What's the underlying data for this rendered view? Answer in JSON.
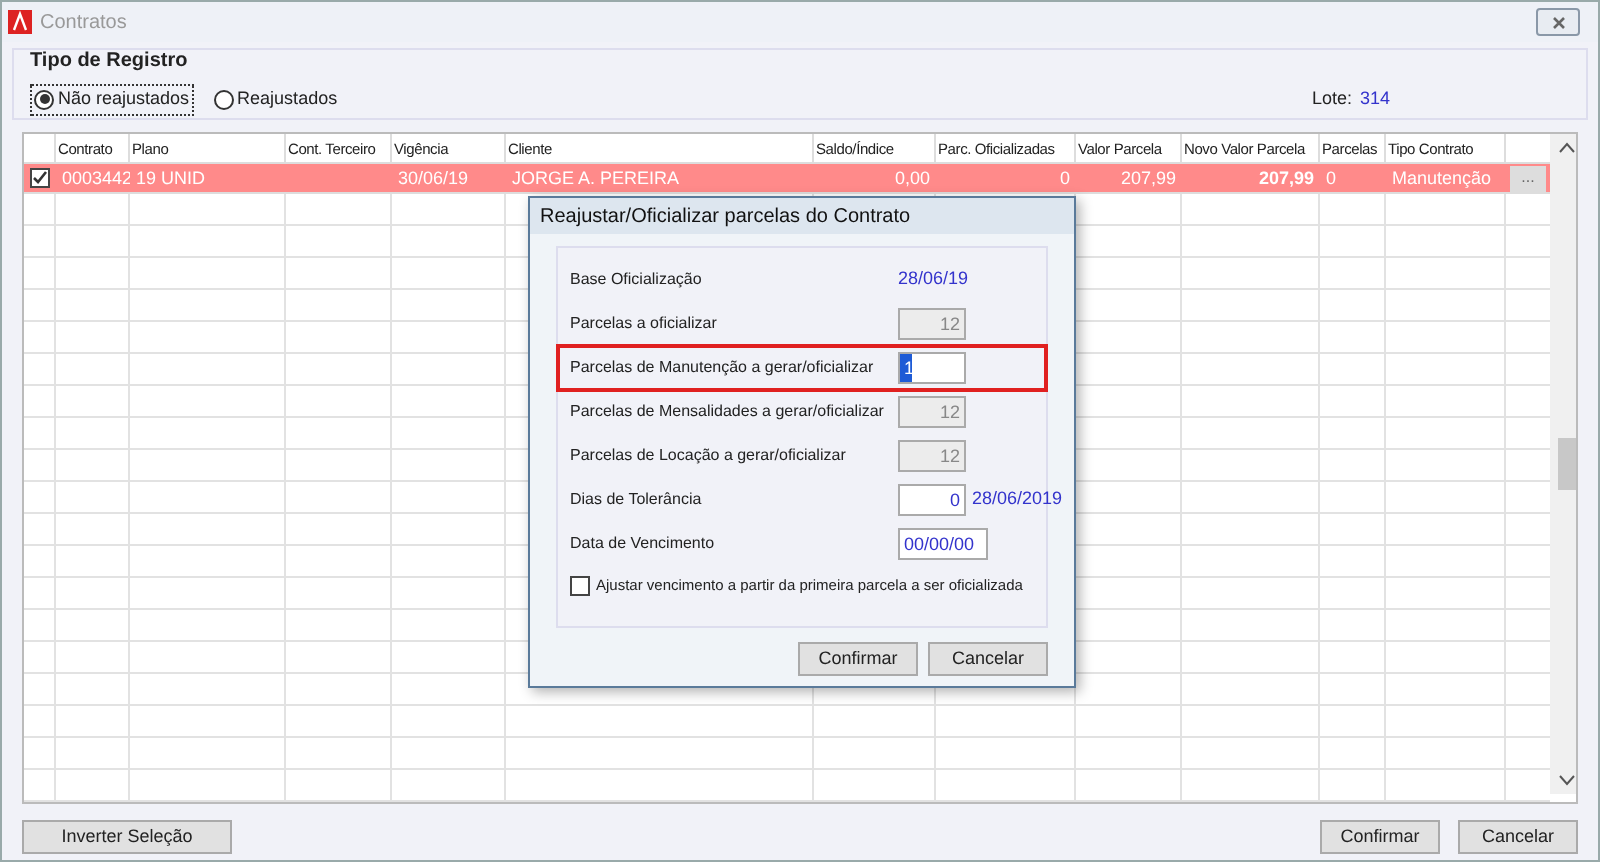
{
  "window": {
    "title": "Contratos"
  },
  "tipo_registro": {
    "title": "Tipo de Registro",
    "options": [
      {
        "label": "Não reajustados",
        "selected": true
      },
      {
        "label": "Reajustados",
        "selected": false
      }
    ]
  },
  "lote": {
    "label": "Lote:",
    "value": "314"
  },
  "table": {
    "columns": [
      {
        "label": "Contrato"
      },
      {
        "label": "Plano"
      },
      {
        "label": "Cont. Terceiro"
      },
      {
        "label": "Vigência"
      },
      {
        "label": "Cliente"
      },
      {
        "label": "Saldo/Índice"
      },
      {
        "label": "Parc. Oficializadas"
      },
      {
        "label": "Valor Parcela"
      },
      {
        "label": "Novo Valor Parcela",
        "bold": true
      },
      {
        "label": "Parcelas"
      },
      {
        "label": "Tipo Contrato"
      }
    ],
    "rows": [
      {
        "checked": true,
        "selected": true,
        "cells": [
          "0003442",
          "19 UNID",
          null,
          "30/06/19",
          "JORGE A. PEREIRA",
          "0,00",
          "0",
          "207,99",
          "207,99",
          "0",
          "Manutenção"
        ],
        "row_button": "..."
      }
    ]
  },
  "dialog": {
    "title": "Reajustar/Oficializar parcelas do Contrato",
    "fields": [
      {
        "kind": "info",
        "label": "Base Oficialização",
        "value": "28/06/19"
      },
      {
        "kind": "readonly",
        "label": "Parcelas a oficializar",
        "value": "12"
      },
      {
        "kind": "input",
        "label": "Parcelas de Manutenção a gerar/oficializar",
        "value": "1",
        "highlighted": true
      },
      {
        "kind": "readonly",
        "label": "Parcelas de Mensalidades a gerar/oficializar",
        "value": "12"
      },
      {
        "kind": "readonly",
        "label": "Parcelas de Locação a gerar/oficializar",
        "value": "12"
      },
      {
        "kind": "input",
        "label": "Dias de Tolerância",
        "value": "0",
        "note": "28/06/2019"
      },
      {
        "kind": "date",
        "label": "Data de Vencimento",
        "value": "00/00/00"
      }
    ],
    "checkbox": {
      "label": "Ajustar vencimento a partir da primeira parcela a ser oficializada",
      "checked": false
    },
    "buttons": [
      "Confirmar",
      "Cancelar"
    ]
  },
  "buttons": {
    "left": "Inverter Seleção",
    "right": [
      "Confirmar",
      "Cancelar"
    ]
  }
}
